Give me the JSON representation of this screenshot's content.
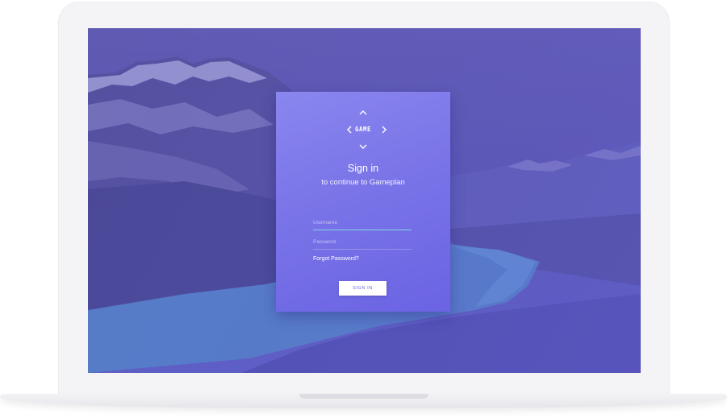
{
  "logo": {
    "text": "GAME"
  },
  "signin": {
    "title": "Sign in",
    "subtitle": "to continue to Gameplan",
    "username_placeholder": "Username",
    "password_placeholder": "Password",
    "forgot_label": "Forgot Password?",
    "button_label": "SIGN IN"
  },
  "colors": {
    "card_gradient_start": "#8a86ef",
    "card_gradient_end": "#6b63e3",
    "username_underline": "#7ed6e8",
    "button_text": "#6a63d9"
  },
  "icons": [
    "chevron-up-icon",
    "chevron-left-icon",
    "chevron-right-icon",
    "chevron-down-icon"
  ]
}
